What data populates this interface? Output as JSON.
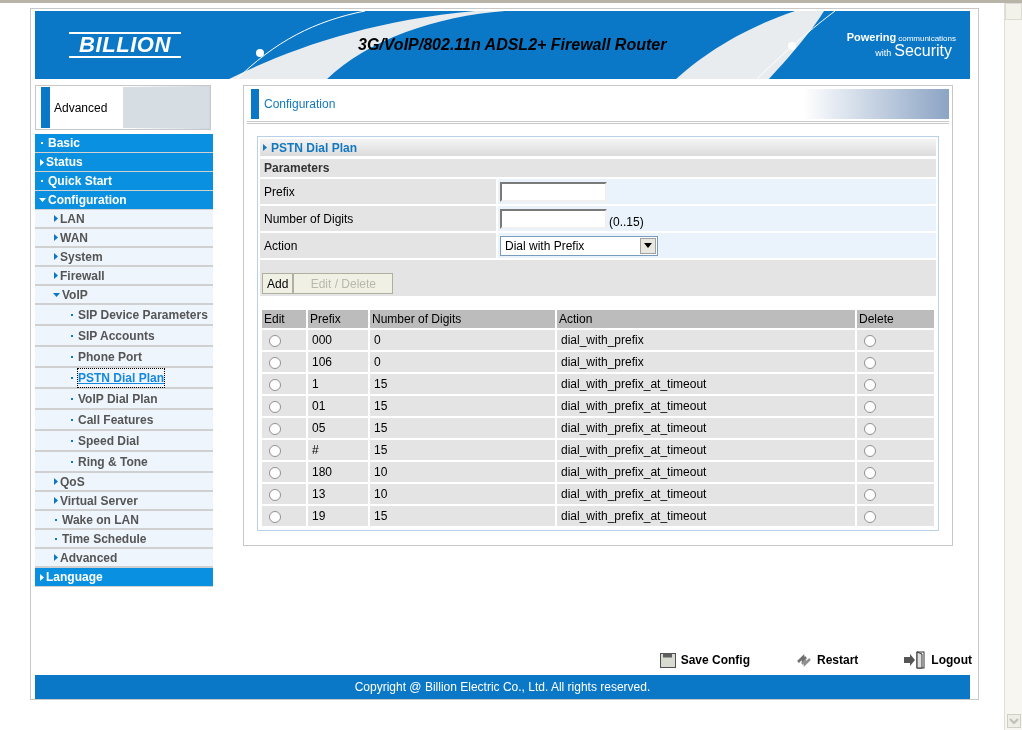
{
  "banner": {
    "logo": "BILLION",
    "title": "3G/VoIP/802.11n ADSL2+ Firewall Router",
    "tagline_small": "Powering communications",
    "tagline_with": "with",
    "tagline_big": "Security"
  },
  "sidebar": {
    "header": "Advanced",
    "items": [
      {
        "label": "Basic",
        "kind": "link",
        "selected": false
      },
      {
        "label": "Status",
        "kind": "folder",
        "expanded": false,
        "selected": false
      },
      {
        "label": "Quick Start",
        "kind": "link",
        "selected": false
      },
      {
        "label": "Configuration",
        "kind": "folder",
        "expanded": true,
        "selected": false,
        "children": [
          {
            "label": "LAN",
            "kind": "folder",
            "expanded": false,
            "selected": false
          },
          {
            "label": "WAN",
            "kind": "folder",
            "expanded": false,
            "selected": false
          },
          {
            "label": "System",
            "kind": "folder",
            "expanded": false,
            "selected": false
          },
          {
            "label": "Firewall",
            "kind": "folder",
            "expanded": false,
            "selected": false
          },
          {
            "label": "VoIP",
            "kind": "folder",
            "expanded": true,
            "selected": false,
            "children": [
              {
                "label": "SIP Device Parameters",
                "kind": "link",
                "selected": false
              },
              {
                "label": "SIP Accounts",
                "kind": "link",
                "selected": false
              },
              {
                "label": "Phone Port",
                "kind": "link",
                "selected": false
              },
              {
                "label": "PSTN Dial Plan",
                "kind": "link",
                "selected": true
              },
              {
                "label": "VoIP Dial Plan",
                "kind": "link",
                "selected": false
              },
              {
                "label": "Call Features",
                "kind": "link",
                "selected": false
              },
              {
                "label": "Speed Dial",
                "kind": "link",
                "selected": false
              },
              {
                "label": "Ring & Tone",
                "kind": "link",
                "selected": false
              }
            ]
          },
          {
            "label": "QoS",
            "kind": "folder",
            "expanded": false,
            "selected": false
          },
          {
            "label": "Virtual Server",
            "kind": "folder",
            "expanded": false,
            "selected": false
          },
          {
            "label": "Wake on LAN",
            "kind": "link",
            "selected": false
          },
          {
            "label": "Time Schedule",
            "kind": "link",
            "selected": false
          },
          {
            "label": "Advanced",
            "kind": "folder",
            "expanded": false,
            "selected": false
          }
        ]
      },
      {
        "label": "Language",
        "kind": "folder",
        "expanded": false,
        "selected": false
      }
    ]
  },
  "main": {
    "title": "Configuration",
    "section": "PSTN Dial Plan",
    "parameters_heading": "Parameters",
    "fields": [
      {
        "label": "Prefix",
        "kind": "text"
      },
      {
        "label": "Number of Digits",
        "kind": "text",
        "hint": "(0..15)"
      },
      {
        "label": "Action",
        "kind": "select",
        "value": "Dial with Prefix"
      }
    ],
    "buttons": [
      {
        "label": "Add",
        "disabled": false
      },
      {
        "label": "Edit / Delete",
        "disabled": true
      }
    ],
    "table": {
      "columns": [
        "Edit",
        "Prefix",
        "Number of Digits",
        "Action",
        "Delete"
      ],
      "rows": [
        {
          "prefix": "000",
          "digits": "0",
          "action": "dial_with_prefix",
          "edit_selected": false,
          "delete_checked": false
        },
        {
          "prefix": "106",
          "digits": "0",
          "action": "dial_with_prefix",
          "edit_selected": false,
          "delete_checked": false
        },
        {
          "prefix": "1",
          "digits": "15",
          "action": "dial_with_prefix_at_timeout",
          "edit_selected": false,
          "delete_checked": false
        },
        {
          "prefix": "01",
          "digits": "15",
          "action": "dial_with_prefix_at_timeout",
          "edit_selected": false,
          "delete_checked": false
        },
        {
          "prefix": "05",
          "digits": "15",
          "action": "dial_with_prefix_at_timeout",
          "edit_selected": false,
          "delete_checked": false
        },
        {
          "prefix": "#",
          "digits": "15",
          "action": "dial_with_prefix_at_timeout",
          "edit_selected": false,
          "delete_checked": false
        },
        {
          "prefix": "180",
          "digits": "10",
          "action": "dial_with_prefix_at_timeout",
          "edit_selected": false,
          "delete_checked": false
        },
        {
          "prefix": "13",
          "digits": "10",
          "action": "dial_with_prefix_at_timeout",
          "edit_selected": false,
          "delete_checked": false
        },
        {
          "prefix": "19",
          "digits": "15",
          "action": "dial_with_prefix_at_timeout",
          "edit_selected": false,
          "delete_checked": false
        }
      ]
    }
  },
  "actions": [
    {
      "label": "Save Config",
      "kind": "save"
    },
    {
      "label": "Restart",
      "kind": "restart"
    },
    {
      "label": "Logout",
      "kind": "logout"
    }
  ],
  "footer": "Copyright @ Billion Electric Co., Ltd. All rights reserved."
}
